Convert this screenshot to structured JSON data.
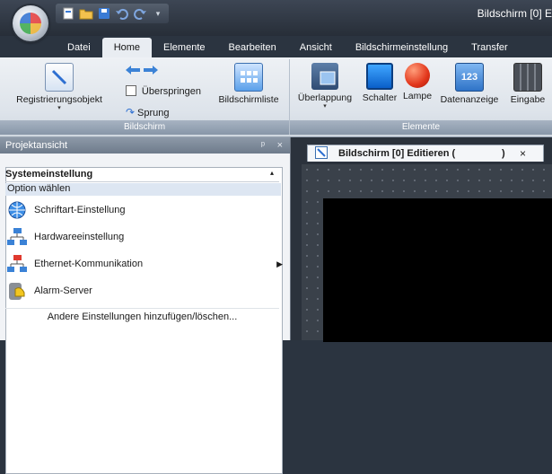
{
  "window": {
    "title": "Bildschirm [0] E"
  },
  "ribbon_tabs": [
    {
      "label": "Datei"
    },
    {
      "label": "Home"
    },
    {
      "label": "Elemente"
    },
    {
      "label": "Bearbeiten"
    },
    {
      "label": "Ansicht"
    },
    {
      "label": "Bildschirmeinstellung"
    },
    {
      "label": "Transfer"
    }
  ],
  "groups": {
    "bildschirm": {
      "title": "Bildschirm",
      "registrierungsobjekt": "Registrierungsobjekt",
      "ueberspringen": "Überspringen",
      "sprung": "Sprung",
      "bildschirmliste": "Bildschirmliste"
    },
    "elemente": {
      "title": "Elemente",
      "ueberlappung": "Überlappung",
      "schalter": "Schalter",
      "lampe": "Lampe",
      "datenanzeige": "Datenanzeige",
      "eingabe": "Eingabe"
    }
  },
  "project_panel": {
    "title": "Projektansicht",
    "pin": "ᵖ",
    "close": "×",
    "section": "Systemeinstellung",
    "selected": "Option wählen",
    "items": [
      {
        "label": "Schriftart-Einstellung"
      },
      {
        "label": "Hardwareeinstellung"
      },
      {
        "label": "Ethernet-Kommunikation"
      },
      {
        "label": "Alarm-Server"
      }
    ],
    "more": "Andere Einstellungen hinzufügen/löschen..."
  },
  "editor": {
    "tab_title": "Bildschirm [0] Editieren (",
    "tab_suffix": ")",
    "tab_close": "×"
  },
  "colors": {
    "accent": "#2d6fd1",
    "ribbon_title": "#8796a8"
  }
}
